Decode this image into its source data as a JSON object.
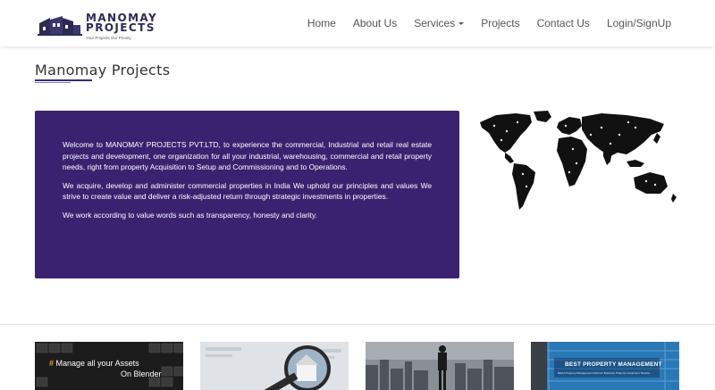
{
  "brand": {
    "name": "MANOMAY\nPROJECTS",
    "tagline": "Your Projects Our Priority",
    "color": "#2d2a55"
  },
  "nav": {
    "items": [
      {
        "label": "Home"
      },
      {
        "label": "About Us"
      },
      {
        "label": "Services",
        "dropdown": true
      },
      {
        "label": "Projects"
      },
      {
        "label": "Contact Us"
      },
      {
        "label": "Login/SignUp"
      }
    ]
  },
  "page": {
    "title": "Manomay Projects"
  },
  "intro": {
    "background": "#3b2270",
    "paragraphs": [
      "Welcome to MANOMAY PROJECTS PVT.LTD, to experience the commercial, Industrial and retail real estate projects and development, one organization for all your industrial, warehousing, commercial and retail property needs, right from property Acquisition to Setup and Commissioning and to Operations.",
      "We acquire, develop and administer commercial properties in India We uphold our principles and values We strive to create value and deliver a risk-adjusted return through strategic investments in properties.",
      "We work according to value words such as transparency, honesty and clarity."
    ]
  },
  "cards": {
    "card1": {
      "hash": "#",
      "line1": "Manage all your Assets",
      "line2": "On Blender"
    },
    "card4": {
      "title": "BEST PROPERTY MANAGEMENT",
      "subtitle": "BHUA Property Management Club For Business Property Investment Tenants"
    }
  },
  "icons": {
    "logo": "buildings-logo-icon",
    "dropdown": "caret-down-icon",
    "map": "world-map-image"
  }
}
